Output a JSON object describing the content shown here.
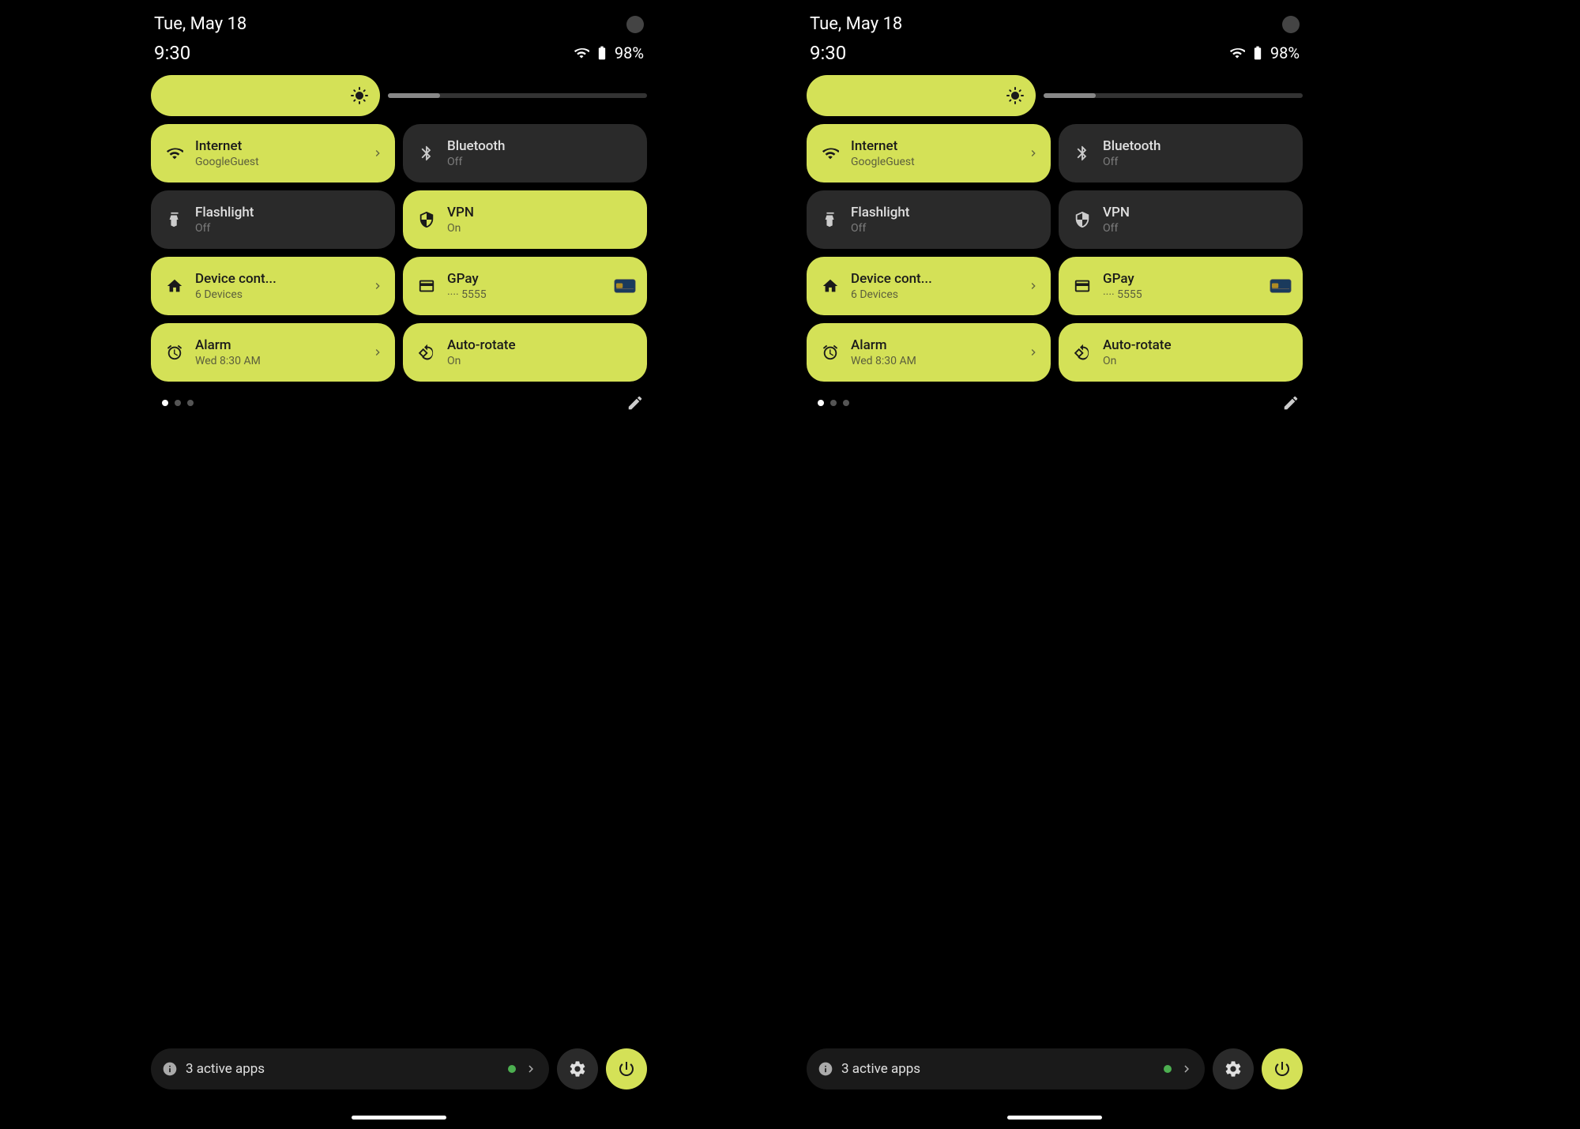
{
  "panels": [
    {
      "id": "panel-1",
      "status": {
        "date": "Tue, May 18",
        "time": "9:30",
        "battery": "98%"
      },
      "brightness": {
        "icon": "⚙"
      },
      "tiles": [
        {
          "id": "internet",
          "title": "Internet",
          "subtitle": "GoogleGuest",
          "active": true,
          "hasArrow": true,
          "icon": "wifi"
        },
        {
          "id": "bluetooth",
          "title": "Bluetooth",
          "subtitle": "Off",
          "active": false,
          "hasArrow": false,
          "icon": "bluetooth"
        },
        {
          "id": "flashlight",
          "title": "Flashlight",
          "subtitle": "Off",
          "active": false,
          "hasArrow": false,
          "icon": "flashlight"
        },
        {
          "id": "vpn",
          "title": "VPN",
          "subtitle": "On",
          "active": true,
          "hasArrow": false,
          "icon": "vpn"
        },
        {
          "id": "device-cont",
          "title": "Device cont...",
          "subtitle": "6 Devices",
          "active": true,
          "hasArrow": true,
          "icon": "home"
        },
        {
          "id": "gpay",
          "title": "GPay",
          "subtitle": "···· 5555",
          "active": true,
          "hasArrow": false,
          "hasCard": true,
          "icon": "credit"
        },
        {
          "id": "alarm",
          "title": "Alarm",
          "subtitle": "Wed 8:30 AM",
          "active": true,
          "hasArrow": true,
          "icon": "alarm"
        },
        {
          "id": "auto-rotate",
          "title": "Auto-rotate",
          "subtitle": "On",
          "active": true,
          "hasArrow": false,
          "icon": "rotate"
        }
      ],
      "bottomBar": {
        "activeApps": "3 active apps"
      }
    },
    {
      "id": "panel-2",
      "status": {
        "date": "Tue, May 18",
        "time": "9:30",
        "battery": "98%"
      },
      "brightness": {
        "icon": "⚙"
      },
      "tiles": [
        {
          "id": "internet",
          "title": "Internet",
          "subtitle": "GoogleGuest",
          "active": true,
          "hasArrow": true,
          "icon": "wifi"
        },
        {
          "id": "bluetooth",
          "title": "Bluetooth",
          "subtitle": "Off",
          "active": false,
          "hasArrow": false,
          "icon": "bluetooth"
        },
        {
          "id": "flashlight",
          "title": "Flashlight",
          "subtitle": "Off",
          "active": false,
          "hasArrow": false,
          "icon": "flashlight"
        },
        {
          "id": "vpn",
          "title": "VPN",
          "subtitle": "Off",
          "active": false,
          "hasArrow": false,
          "icon": "vpn"
        },
        {
          "id": "device-cont",
          "title": "Device cont...",
          "subtitle": "6 Devices",
          "active": true,
          "hasArrow": true,
          "icon": "home"
        },
        {
          "id": "gpay",
          "title": "GPay",
          "subtitle": "···· 5555",
          "active": true,
          "hasArrow": false,
          "hasCard": true,
          "icon": "credit"
        },
        {
          "id": "alarm",
          "title": "Alarm",
          "subtitle": "Wed 8:30 AM",
          "active": true,
          "hasArrow": true,
          "icon": "alarm"
        },
        {
          "id": "auto-rotate",
          "title": "Auto-rotate",
          "subtitle": "On",
          "active": true,
          "hasArrow": false,
          "icon": "rotate"
        }
      ],
      "bottomBar": {
        "activeApps": "3 active apps"
      }
    }
  ],
  "labels": {
    "edit_icon": "✏",
    "info_icon": "ⓘ",
    "chevron": "›",
    "settings": "⚙",
    "power": "⏻"
  }
}
